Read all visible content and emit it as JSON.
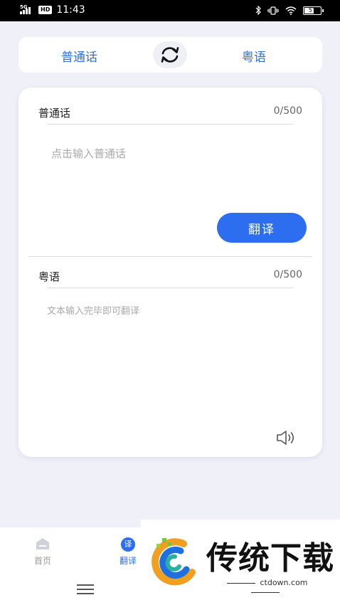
{
  "status": {
    "network": "5G",
    "hd": "HD",
    "time": "11:43",
    "battery": "57"
  },
  "lang_bar": {
    "source": "普通话",
    "target": "粤语",
    "swap_icon": "swap-refresh-icon"
  },
  "source_panel": {
    "label": "普通话",
    "count": "0/500",
    "input_value": "",
    "placeholder": "点击输入普通话",
    "translate_button": "翻译"
  },
  "target_panel": {
    "label": "粤语",
    "count": "0/500",
    "hint": "文本输入完毕即可翻译",
    "speaker_icon": "speaker-icon"
  },
  "nav": {
    "home": "首页",
    "translate_badge": "译",
    "translate": "翻译"
  },
  "watermark": {
    "logo_text": "传统下载",
    "url": "ctdown.com"
  },
  "colors": {
    "accent": "#2d6ef0",
    "background": "#f0f1f8"
  }
}
